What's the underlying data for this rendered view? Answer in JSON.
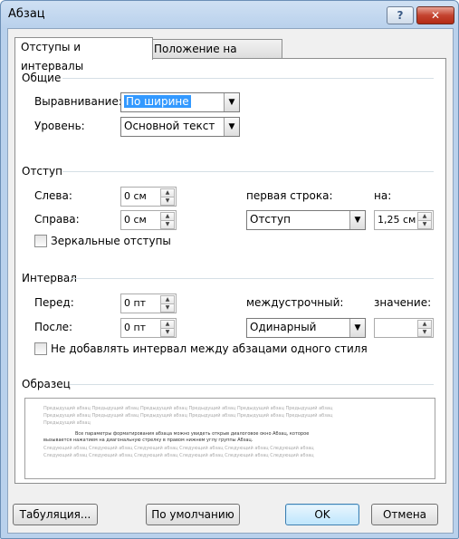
{
  "window": {
    "title": "Абзац",
    "help_label": "?",
    "close_label": "✕"
  },
  "tabs": [
    "Отступы и интервалы",
    "Положение на странице"
  ],
  "general": {
    "group": "Общие",
    "alignment_label": "Выравнивание:",
    "alignment_value": "По ширине",
    "level_label": "Уровень:",
    "level_value": "Основной текст"
  },
  "indent": {
    "group": "Отступ",
    "left_label": "Слева:",
    "left_value": "0 см",
    "right_label": "Справа:",
    "right_value": "0 см",
    "first_line_label": "первая строка:",
    "first_line_value": "Отступ",
    "by_label": "на:",
    "by_value": "1,25 см",
    "mirror_label": "Зеркальные отступы"
  },
  "spacing": {
    "group": "Интервал",
    "before_label": "Перед:",
    "before_value": "0 пт",
    "after_label": "После:",
    "after_value": "0 пт",
    "line_label": "междустрочный:",
    "line_value": "Одинарный",
    "at_label": "значение:",
    "at_value": "",
    "no_space_label": "Не добавлять интервал между абзацами одного стиля"
  },
  "preview": {
    "group": "Образец",
    "prev1": "Предыдущий абзац Предыдущий абзац Предыдущий абзац Предыдущий абзац Предыдущий абзац Предыдущий абзац",
    "prev2": "Предыдущий абзац Предыдущий абзац Предыдущий абзац Предыдущий абзац Предыдущий абзац Предыдущий абзац",
    "prev3": "Предыдущий абзац",
    "cur1": "Все параметры форматирования абзаца можно увидеть открыв диалоговое окно Абзац, которое",
    "cur2": "вызывается нажатием на диагональную стрелку в правом нижнем углу группы Абзац.",
    "next1": "Следующий абзац Следующий абзац Следующий абзац Следующий абзац Следующий абзац Следующий абзац",
    "next2": "Следующий абзац Следующий абзац Следующий абзац Следующий абзац Следующий абзац Следующий абзац"
  },
  "buttons": {
    "tabs": "Табуляция...",
    "default": "По умолчанию",
    "ok": "OK",
    "cancel": "Отмена"
  }
}
